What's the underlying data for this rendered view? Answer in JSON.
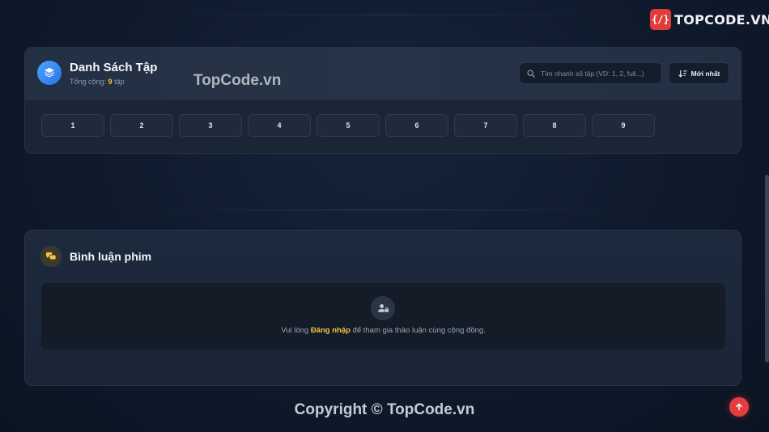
{
  "brand": {
    "icon_text": "{/}",
    "name_prefix": "T",
    "name_rest": "OPCODE.VN"
  },
  "watermark": "TopCode.vn",
  "episodes": {
    "title": "Danh Sách Tập",
    "total_prefix": "Tổng cộng:",
    "total_count": "9",
    "total_suffix": "tập",
    "search_placeholder": "Tìm nhanh số tập (VD: 1, 2, full...)",
    "sort_label": "Mới nhất",
    "items": [
      "1",
      "2",
      "3",
      "4",
      "5",
      "6",
      "7",
      "8",
      "9"
    ]
  },
  "comments": {
    "title": "Bình luận phim",
    "login_prefix": "Vui lòng",
    "login_link": "Đăng nhập",
    "login_suffix": "để tham gia thảo luận cùng cộng đồng."
  },
  "footer": {
    "copyright": "Copyright © TopCode.vn"
  },
  "colors": {
    "accent_yellow": "#f5c542",
    "scroll_top_red": "#e43d3d",
    "layers_blue": "#2f86f0"
  }
}
